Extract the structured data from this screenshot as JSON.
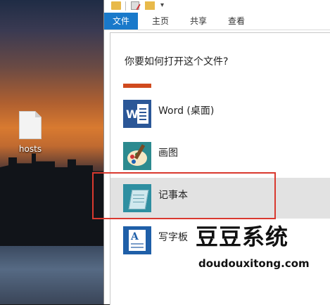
{
  "desktop": {
    "file_icon": "text-file-icon",
    "file_label": "hosts"
  },
  "explorer": {
    "quick_access_icons": [
      "folder-icon",
      "properties-icon",
      "new-folder-icon",
      "dropdown-icon"
    ],
    "dropdown_glyph": "▾",
    "tabs": [
      {
        "label": "文件",
        "active": true
      },
      {
        "label": "主页",
        "active": false
      },
      {
        "label": "共享",
        "active": false
      },
      {
        "label": "查看",
        "active": false
      }
    ],
    "accent_color": "#1979ca"
  },
  "open_with": {
    "question": "你要如何打开这个文件?",
    "apps": [
      {
        "name": "Word (桌面)",
        "icon": "word-icon",
        "selected": false
      },
      {
        "name": "画图",
        "icon": "paint-icon",
        "selected": false
      },
      {
        "name": "记事本",
        "icon": "notepad-icon",
        "selected": true
      },
      {
        "name": "写字板",
        "icon": "wordpad-icon",
        "selected": false
      }
    ],
    "highlight_color": "#d9392f"
  },
  "watermark": {
    "title": "豆豆系统",
    "url": "doudouxitong.com"
  }
}
